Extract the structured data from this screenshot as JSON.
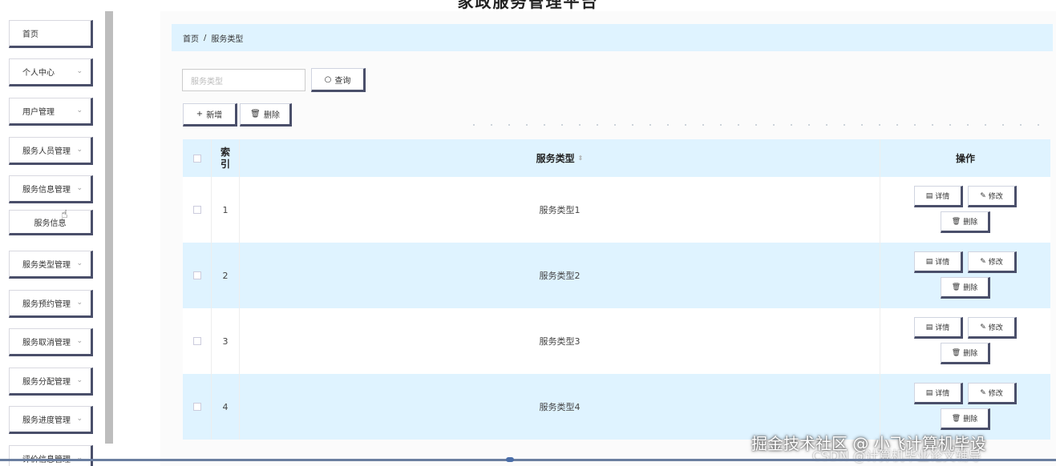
{
  "app": {
    "title": "家政服务管理平台"
  },
  "sidebar": {
    "items": [
      {
        "label": "首页",
        "has_chevron": false
      },
      {
        "label": "个人中心",
        "has_chevron": true
      },
      {
        "label": "用户管理",
        "has_chevron": true
      },
      {
        "label": "服务人员管理",
        "has_chevron": true
      },
      {
        "label": "服务信息管理",
        "has_chevron": true
      },
      {
        "label": "服务类型管理",
        "has_chevron": true
      },
      {
        "label": "服务预约管理",
        "has_chevron": true
      },
      {
        "label": "服务取消管理",
        "has_chevron": true
      },
      {
        "label": "服务分配管理",
        "has_chevron": true
      },
      {
        "label": "服务进度管理",
        "has_chevron": true
      },
      {
        "label": "评价信息管理",
        "has_chevron": true
      }
    ],
    "subitem": {
      "label": "服务信息"
    }
  },
  "breadcrumb": {
    "home": "首页",
    "separator": "/",
    "current": "服务类型"
  },
  "search": {
    "placeholder": "服务类型",
    "button_label": "查询"
  },
  "toolbar": {
    "add_label": "新增",
    "delete_label": "删除"
  },
  "table": {
    "headers": {
      "index": [
        "索",
        "引"
      ],
      "type": "服务类型",
      "actions": "操作"
    },
    "rows": [
      {
        "index": "1",
        "type": "服务类型1"
      },
      {
        "index": "2",
        "type": "服务类型2"
      },
      {
        "index": "3",
        "type": "服务类型3"
      },
      {
        "index": "4",
        "type": "服务类型4"
      }
    ],
    "row_actions": {
      "detail": "详情",
      "edit": "修改",
      "delete": "删除"
    }
  },
  "watermark": {
    "line1": "掘金技术社区 @ 小飞计算机毕设",
    "line2": "CSDN @计算机毕业论文辅导"
  },
  "colors": {
    "accent_bg": "#dff3ff",
    "button_shadow": "#4a4f6a",
    "progress": "#6b7fa0"
  }
}
